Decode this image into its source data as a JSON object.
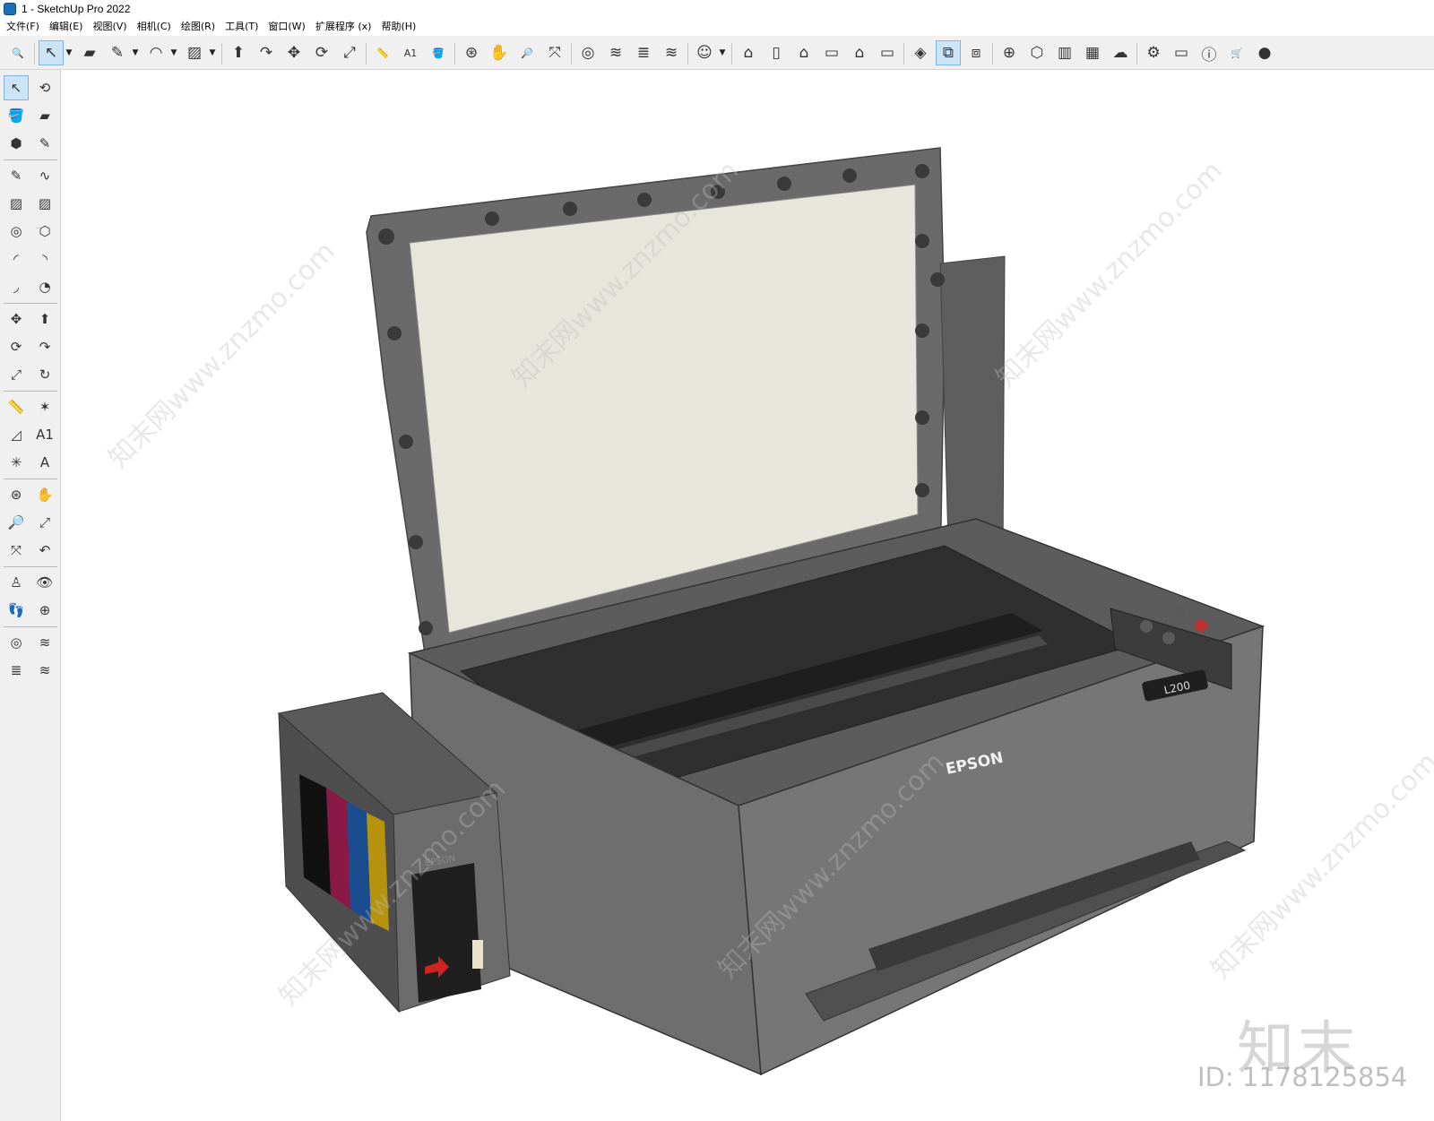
{
  "window": {
    "title": "1 - SketchUp Pro 2022"
  },
  "menu": [
    "文件(F)",
    "编辑(E)",
    "视图(V)",
    "相机(C)",
    "绘图(R)",
    "工具(T)",
    "窗口(W)",
    "扩展程序 (x)",
    "帮助(H)"
  ],
  "top_toolbar": [
    {
      "name": "zoom-icon",
      "sym": "🔍"
    },
    {
      "name": "select-icon",
      "sym": "↖",
      "selected": true,
      "drop": true
    },
    {
      "name": "eraser-icon",
      "sym": "▰"
    },
    {
      "name": "pencil-line-icon",
      "sym": "✎",
      "drop": true
    },
    {
      "name": "arc-icon",
      "sym": "◠",
      "drop": true
    },
    {
      "name": "rectangle-icon",
      "sym": "▨",
      "drop": true
    },
    {
      "name": "push-pull-icon",
      "sym": "⬆"
    },
    {
      "name": "follow-me-icon",
      "sym": "↷"
    },
    {
      "name": "move-icon",
      "sym": "✥"
    },
    {
      "name": "rotate-icon",
      "sym": "⟳"
    },
    {
      "name": "scale-icon",
      "sym": "⤢"
    },
    {
      "name": "tape-measure-icon",
      "sym": "📏"
    },
    {
      "name": "text-icon",
      "sym": "A1"
    },
    {
      "name": "paint-bucket-icon",
      "sym": "🪣"
    },
    {
      "name": "orbit-icon",
      "sym": "⊛"
    },
    {
      "name": "pan-icon",
      "sym": "✋"
    },
    {
      "name": "zoom-tool-icon",
      "sym": "🔎"
    },
    {
      "name": "zoom-extents-icon",
      "sym": "⤧"
    },
    {
      "name": "warehouse-icon",
      "sym": "◎"
    },
    {
      "name": "extension-icon",
      "sym": "≋"
    },
    {
      "name": "layers-icon",
      "sym": "≣"
    },
    {
      "name": "extension2-icon",
      "sym": "≋"
    },
    {
      "name": "user-icon",
      "sym": "☺",
      "drop": true
    },
    {
      "name": "iso-view-icon",
      "sym": "⌂"
    },
    {
      "name": "top-view-icon",
      "sym": "▯"
    },
    {
      "name": "front-view-icon",
      "sym": "⌂"
    },
    {
      "name": "right-view-icon",
      "sym": "▭"
    },
    {
      "name": "back-view-icon",
      "sym": "⌂"
    },
    {
      "name": "left-view-icon",
      "sym": "▭"
    },
    {
      "name": "styles-icon",
      "sym": "◈"
    },
    {
      "name": "section-plane-icon",
      "sym": "⧉",
      "selected": true
    },
    {
      "name": "section-display-icon",
      "sym": "⧈"
    },
    {
      "name": "add-location-icon",
      "sym": "⊕"
    },
    {
      "name": "shadow-icon",
      "sym": "⬡"
    },
    {
      "name": "materials-icon",
      "sym": "▥"
    },
    {
      "name": "pattern-icon",
      "sym": "▦"
    },
    {
      "name": "cloud-upload-icon",
      "sym": "☁"
    },
    {
      "name": "settings-icon",
      "sym": "⚙"
    },
    {
      "name": "chat-icon",
      "sym": "▭"
    },
    {
      "name": "info-icon",
      "sym": "ⓘ"
    },
    {
      "name": "cart-icon",
      "sym": "🛒"
    },
    {
      "name": "account-icon",
      "sym": "●"
    }
  ],
  "left_toolbar": [
    [
      "select-tool-icon",
      "orbit-tool-icon"
    ],
    [
      "paint-tool-icon",
      "eraser-tool-icon"
    ],
    [
      "component-tool-icon",
      "tag-tool-icon"
    ],
    [
      "line-tool-icon",
      "freehand-tool-icon"
    ],
    [
      "rect-tool-icon",
      "rotated-rect-tool-icon"
    ],
    [
      "circle-tool-icon",
      "polygon-tool-icon"
    ],
    [
      "arc-tool-icon",
      "two-point-arc-tool-icon"
    ],
    [
      "three-point-arc-tool-icon",
      "pie-tool-icon"
    ],
    [
      "move-tool-icon",
      "push-pull-tool-icon"
    ],
    [
      "rotate-tool-icon",
      "follow-me-tool-icon"
    ],
    [
      "scale-tool-icon",
      "offset-tool-icon"
    ],
    [
      "tape-tool-icon",
      "dimension-tool-icon"
    ],
    [
      "protractor-tool-icon",
      "text-tool-icon"
    ],
    [
      "axes-tool-icon",
      "3d-text-tool-icon"
    ],
    [
      "orbit2-tool-icon",
      "pan-tool-icon"
    ],
    [
      "zoom2-tool-icon",
      "zoom-window-tool-icon"
    ],
    [
      "zoom-extents2-tool-icon",
      "previous-view-tool-icon"
    ],
    [
      "position-camera-tool-icon",
      "look-around-tool-icon"
    ],
    [
      "walk-tool-icon",
      "section-tool-icon"
    ],
    [
      "warehouse2-tool-icon",
      "extension-warehouse-tool-icon"
    ],
    [
      "layer-tool-icon",
      "extension3-tool-icon"
    ]
  ],
  "model": {
    "brand_label": "EPSON",
    "model_label": "L200",
    "tank_brand": "EPSON"
  },
  "watermark": {
    "brand": "知末",
    "id": "ID: 1178125854",
    "diag": "知末网www.znzmo.com"
  },
  "colors": {
    "toolbar_bg": "#f0f0f0",
    "selected_bg": "#cce4f7",
    "printer_body": "#6e6e6e",
    "printer_dark": "#3c3c3c",
    "glass": "#e6e6dc"
  }
}
